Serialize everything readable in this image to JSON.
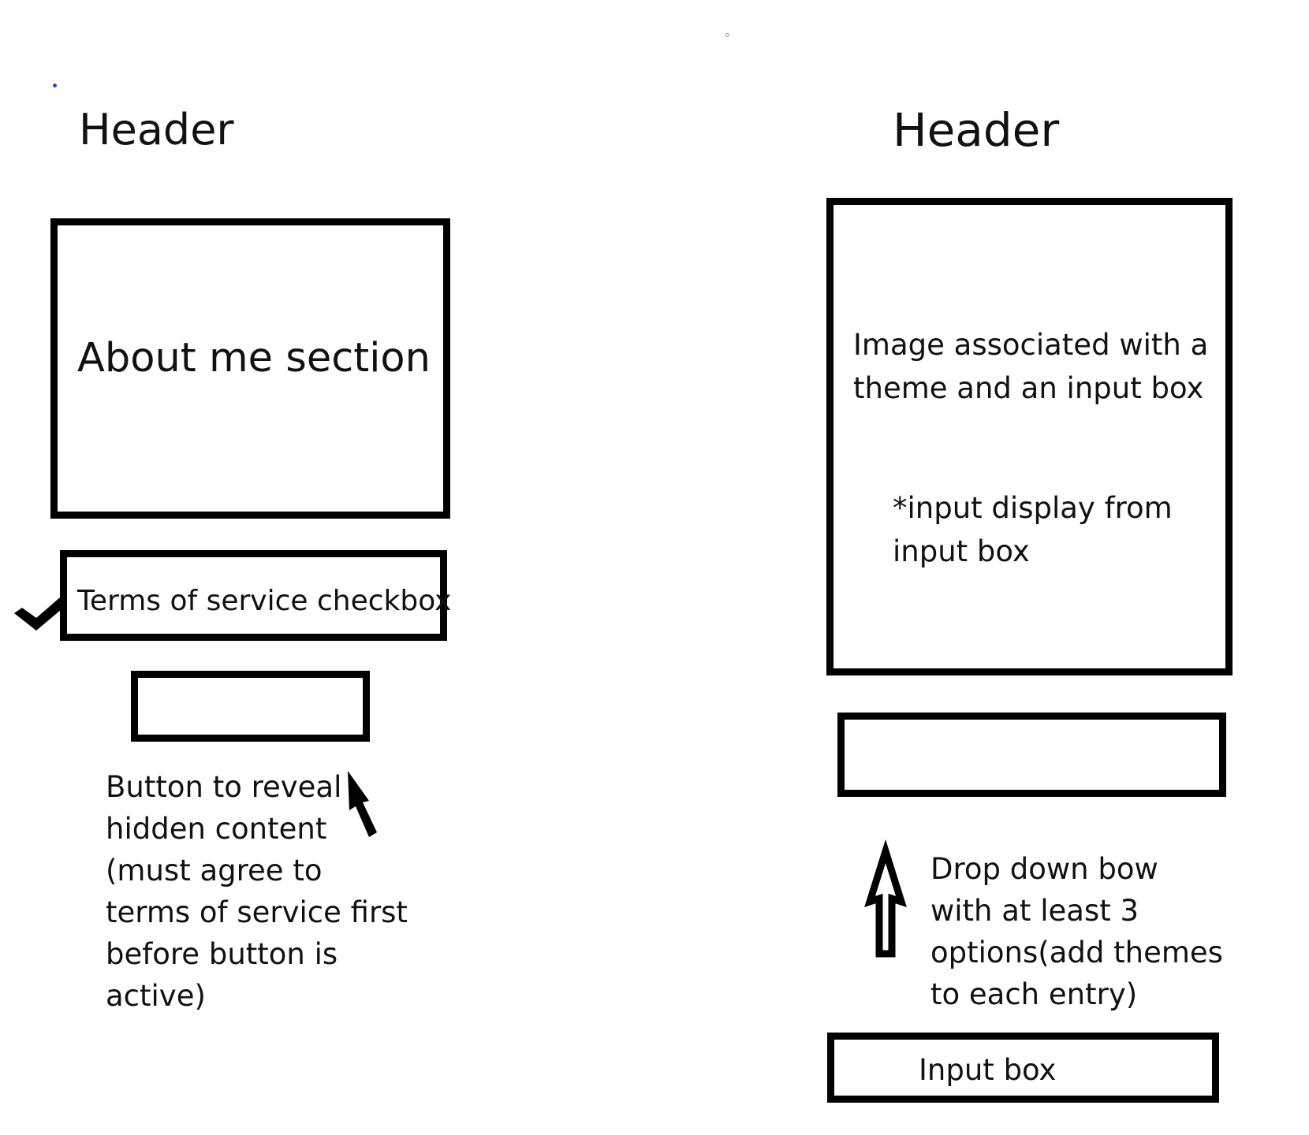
{
  "left": {
    "header": "Header",
    "about_label": "About me section",
    "tos_label": "Terms of service checkbox",
    "button_note_lines": [
      "Button to reveal",
      "hidden content",
      "(must agree to",
      "terms of service first",
      "before button is",
      "active)"
    ]
  },
  "right": {
    "header": "Header",
    "image_label_lines": [
      "Image associated with a",
      "theme and an input box"
    ],
    "input_display_lines": [
      "*input display from",
      "input box"
    ],
    "dropdown_note_lines": [
      "Drop down bow",
      "with at least 3",
      "options(add themes",
      "to each entry)"
    ],
    "input_box_label": "Input box"
  },
  "icons": {
    "checkmark": "checkmark-icon",
    "cursor": "cursor-arrow-icon",
    "up_arrow": "up-arrow-icon"
  },
  "colors": {
    "stroke": "#000000",
    "stray_dot": "#3344cc"
  }
}
